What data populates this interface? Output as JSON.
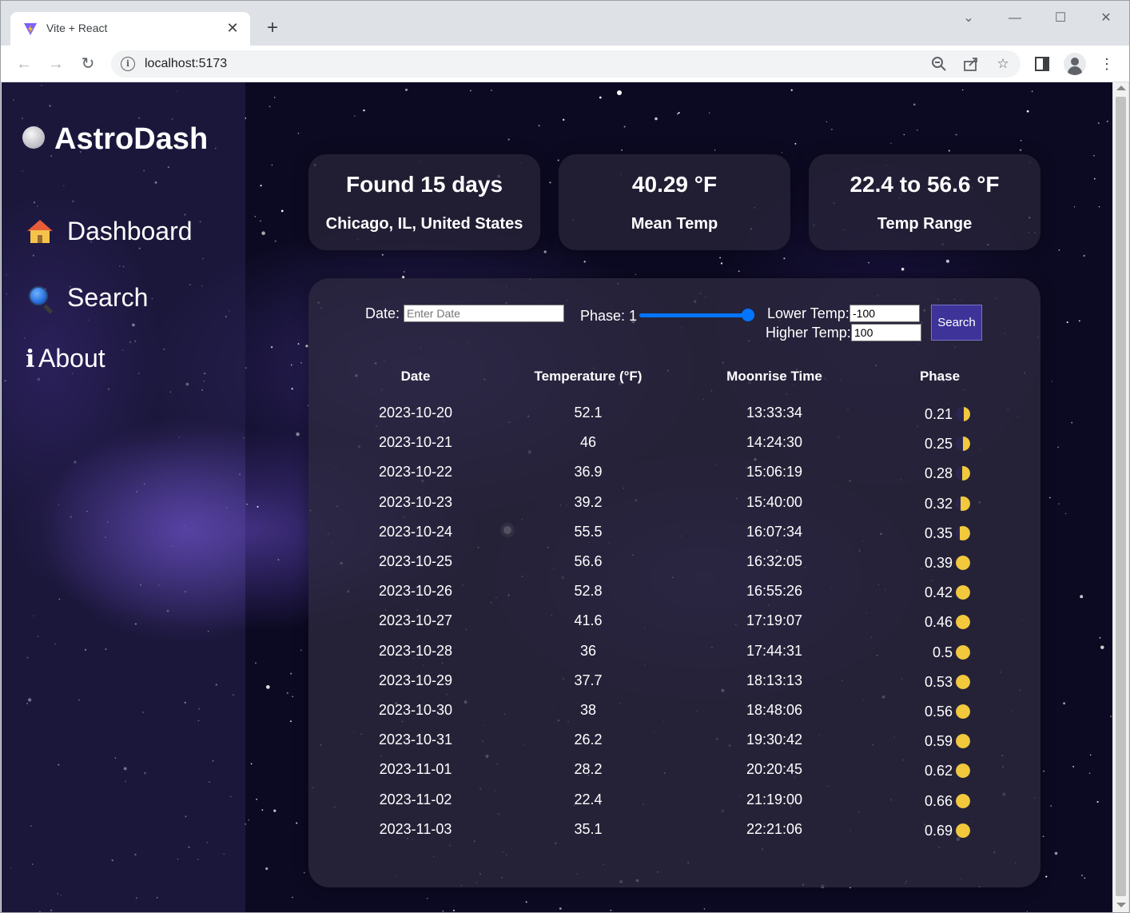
{
  "browser": {
    "tab_title": "Vite + React",
    "url": "localhost:5173"
  },
  "sidebar": {
    "brand": "AstroDash",
    "items": [
      {
        "label": "Dashboard",
        "icon": "house-icon"
      },
      {
        "label": "Search",
        "icon": "magnifier-icon"
      },
      {
        "label": "About",
        "icon": "info-icon"
      }
    ]
  },
  "cards": [
    {
      "value": "Found 15 days",
      "label": "Chicago, IL, United States"
    },
    {
      "value": "40.29 °F",
      "label": "Mean Temp"
    },
    {
      "value": "22.4 to 56.6 °F",
      "label": "Temp Range"
    }
  ],
  "filters": {
    "date_label": "Date:",
    "date_placeholder": "Enter Date",
    "phase_label": "Phase: 1",
    "phase_value": 1,
    "lower_label": "Lower Temp:",
    "lower_value": "-100",
    "higher_label": "Higher Temp:",
    "higher_value": "100",
    "search_label": "Search"
  },
  "table": {
    "headers": [
      "Date",
      "Temperature (°F)",
      "Moonrise Time",
      "Phase"
    ],
    "rows": [
      {
        "date": "2023-10-20",
        "temp": "52.1",
        "moonrise": "13:33:34",
        "phase": "0.21"
      },
      {
        "date": "2023-10-21",
        "temp": "46",
        "moonrise": "14:24:30",
        "phase": "0.25"
      },
      {
        "date": "2023-10-22",
        "temp": "36.9",
        "moonrise": "15:06:19",
        "phase": "0.28"
      },
      {
        "date": "2023-10-23",
        "temp": "39.2",
        "moonrise": "15:40:00",
        "phase": "0.32"
      },
      {
        "date": "2023-10-24",
        "temp": "55.5",
        "moonrise": "16:07:34",
        "phase": "0.35"
      },
      {
        "date": "2023-10-25",
        "temp": "56.6",
        "moonrise": "16:32:05",
        "phase": "0.39"
      },
      {
        "date": "2023-10-26",
        "temp": "52.8",
        "moonrise": "16:55:26",
        "phase": "0.42"
      },
      {
        "date": "2023-10-27",
        "temp": "41.6",
        "moonrise": "17:19:07",
        "phase": "0.46"
      },
      {
        "date": "2023-10-28",
        "temp": "36",
        "moonrise": "17:44:31",
        "phase": "0.5"
      },
      {
        "date": "2023-10-29",
        "temp": "37.7",
        "moonrise": "18:13:13",
        "phase": "0.53"
      },
      {
        "date": "2023-10-30",
        "temp": "38",
        "moonrise": "18:48:06",
        "phase": "0.56"
      },
      {
        "date": "2023-10-31",
        "temp": "26.2",
        "moonrise": "19:30:42",
        "phase": "0.59"
      },
      {
        "date": "2023-11-01",
        "temp": "28.2",
        "moonrise": "20:20:45",
        "phase": "0.62"
      },
      {
        "date": "2023-11-02",
        "temp": "22.4",
        "moonrise": "21:19:00",
        "phase": "0.66"
      },
      {
        "date": "2023-11-03",
        "temp": "35.1",
        "moonrise": "22:21:06",
        "phase": "0.69"
      }
    ]
  },
  "colors": {
    "moon_lit": "#f2c83c",
    "search_button": "#3d3399",
    "slider": "#0075ff"
  }
}
